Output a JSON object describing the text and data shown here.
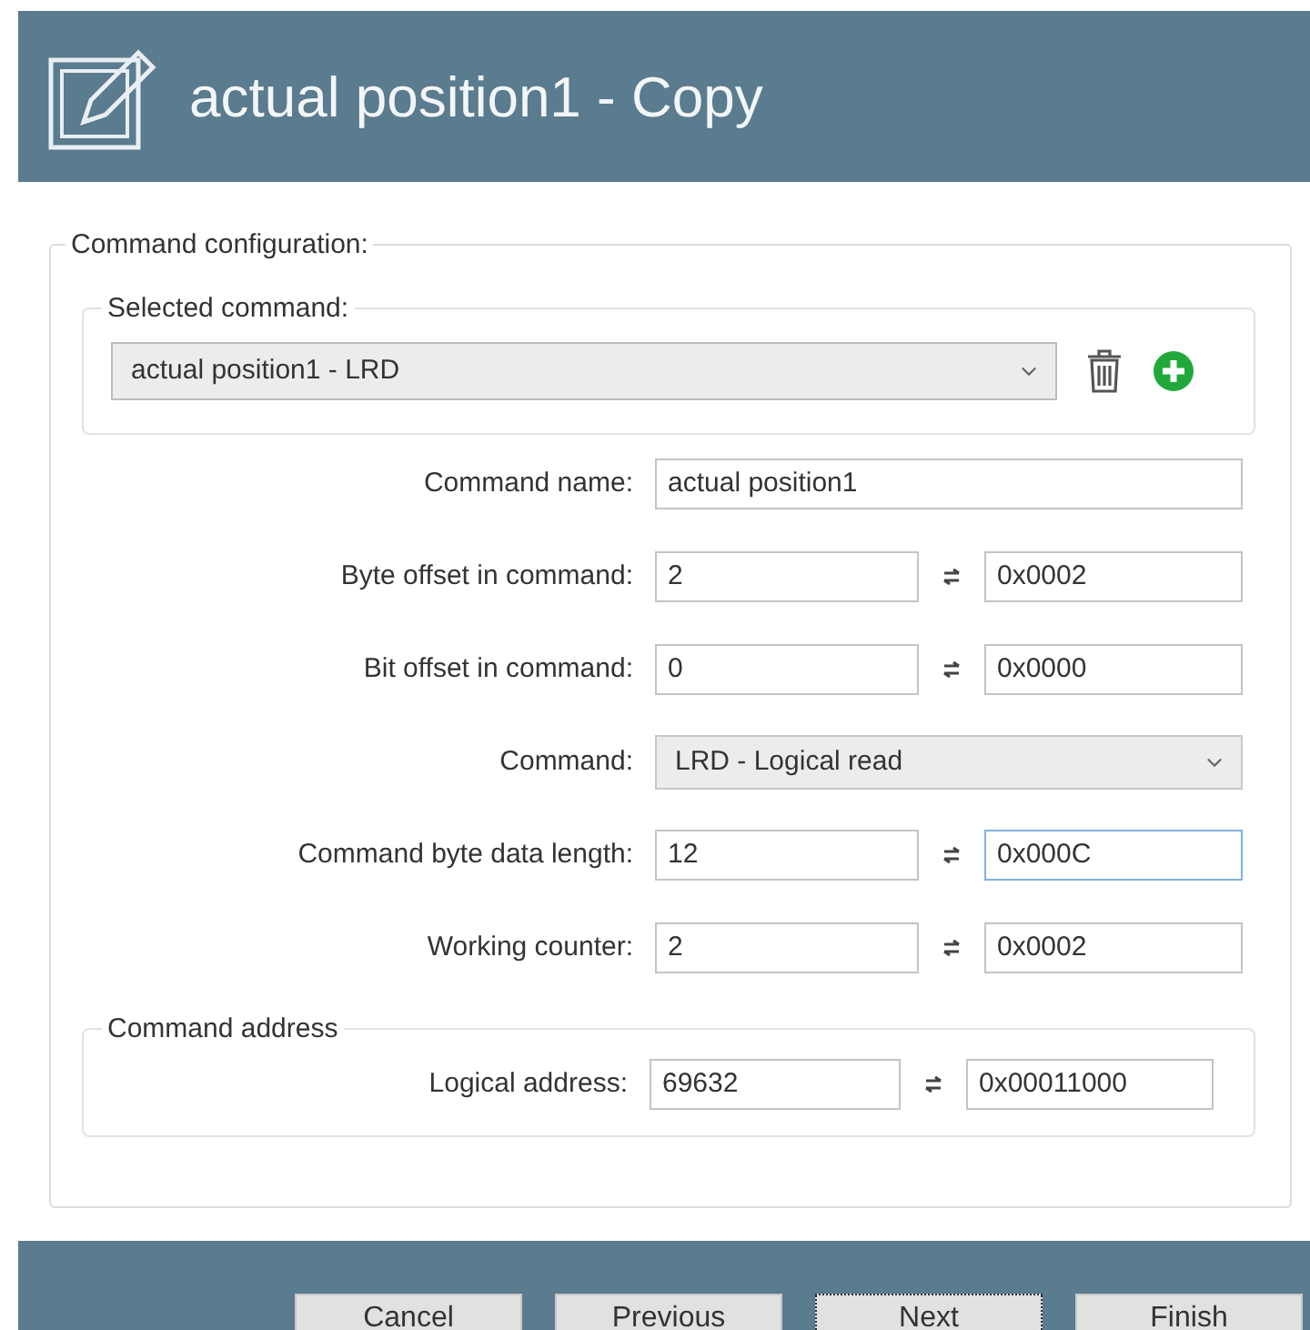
{
  "window": {
    "title": "actual position1 - Copy"
  },
  "group": {
    "title": "Command configuration:"
  },
  "selected_command": {
    "title": "Selected command:",
    "value": "actual position1 - LRD"
  },
  "fields": [
    {
      "kind": "text",
      "label": "Command name:",
      "value": "actual position1"
    },
    {
      "kind": "pair",
      "label": "Byte offset in command:",
      "value": "2",
      "hex": "0x0002",
      "hex_focused": false
    },
    {
      "kind": "pair",
      "label": "Bit offset in command:",
      "value": "0",
      "hex": "0x0000",
      "hex_focused": false
    },
    {
      "kind": "dropdown",
      "label": "Command:",
      "value": "LRD - Logical read"
    },
    {
      "kind": "pair",
      "label": "Command byte data length:",
      "value": "12",
      "hex": "0x000C",
      "hex_focused": true
    },
    {
      "kind": "pair",
      "label": "Working counter:",
      "value": "2",
      "hex": "0x0002",
      "hex_focused": false
    }
  ],
  "address": {
    "title": "Command address",
    "label": "Logical address:",
    "value": "69632",
    "hex": "0x00011000"
  },
  "buttons": [
    {
      "label": "Cancel",
      "focused": false
    },
    {
      "label": "Previous",
      "focused": false
    },
    {
      "label": "Next",
      "focused": true
    },
    {
      "label": "Finish",
      "focused": false
    }
  ]
}
